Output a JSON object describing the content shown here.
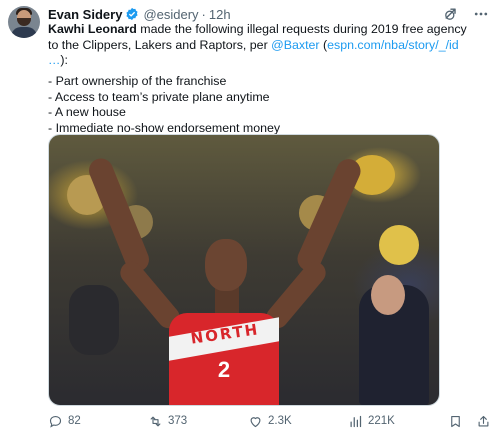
{
  "author": {
    "name": "Evan Sidery",
    "handle": "@esidery",
    "separator": "·",
    "time": "12h",
    "verified_color": "#1d9bf0"
  },
  "post": {
    "line1_bold": "Kawhi Leonard",
    "line1_rest": " made the following illegal requests during 2019 free agency",
    "line2_pre": "to the Clippers, Lakers and Raptors, per ",
    "mention": "@Baxter",
    "link_open": " (",
    "link": "espn.com/nba/story/_/id",
    "line3_link": "…",
    "line3_rest": "):",
    "list": [
      "- Part ownership of the franchise",
      "- Access to team’s private plane anytime",
      "- A new house",
      "- Immediate no-show endorsement money"
    ]
  },
  "media": {
    "jersey_text": "NORTH",
    "jersey_number": "2"
  },
  "actions": {
    "replies": "82",
    "reposts": "373",
    "likes": "2.3K",
    "views": "221K"
  },
  "icons": [
    "verified-icon",
    "grok-icon",
    "more-icon",
    "reply-icon",
    "repost-icon",
    "like-icon",
    "views-icon",
    "bookmark-icon",
    "share-icon"
  ],
  "colors": {
    "link": "#1d9bf0",
    "muted": "#536471",
    "text": "#0f1419"
  }
}
